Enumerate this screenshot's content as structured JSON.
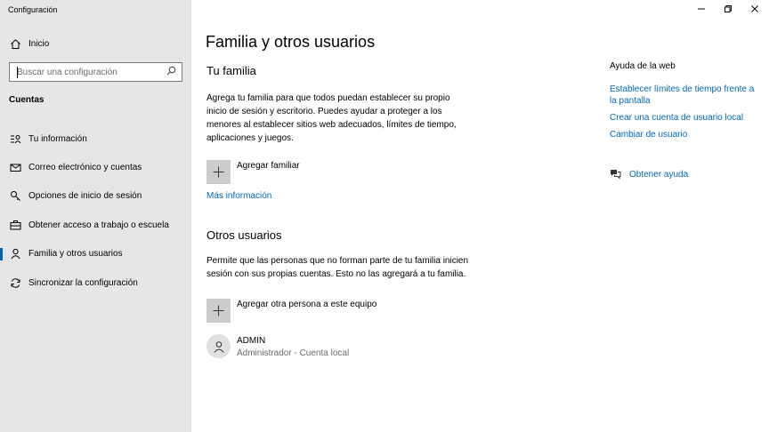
{
  "window": {
    "title": "Configuración",
    "controls": [
      "minimize-icon",
      "restore-icon",
      "close-icon"
    ]
  },
  "sidebar": {
    "home_label": "Inicio",
    "search_placeholder": "Buscar una configuración",
    "section_title": "Cuentas",
    "items": [
      {
        "label": "Tu información",
        "icon": "person-card-icon",
        "active": false
      },
      {
        "label": "Correo electrónico y cuentas",
        "icon": "mail-icon",
        "active": false
      },
      {
        "label": "Opciones de inicio de sesión",
        "icon": "key-icon",
        "active": false
      },
      {
        "label": "Obtener acceso a trabajo o escuela",
        "icon": "briefcase-icon",
        "active": false
      },
      {
        "label": "Familia y otros usuarios",
        "icon": "person-icon",
        "active": true
      },
      {
        "label": "Sincronizar la configuración",
        "icon": "sync-icon",
        "active": false
      }
    ]
  },
  "main": {
    "title": "Familia y otros usuarios",
    "family": {
      "heading": "Tu familia",
      "description": "Agrega tu familia para que todos puedan establecer su propio inicio de sesión y escritorio. Puedes ayudar a proteger a los menores al establecer sitios web adecuados, límites de tiempo, aplicaciones y juegos.",
      "add_label": "Agregar familiar",
      "more_info": "Más información"
    },
    "others": {
      "heading": "Otros usuarios",
      "description": "Permite que las personas que no forman parte de tu familia inicien sesión con sus propias cuentas. Esto no las agregará a tu familia.",
      "add_label": "Agregar otra persona a este equipo",
      "user": {
        "name": "ADMIN",
        "detail": "Administrador - Cuenta local"
      }
    }
  },
  "help": {
    "heading": "Ayuda de la web",
    "links": [
      "Establecer límites de tiempo frente a la pantalla",
      "Crear una cuenta de usuario local",
      "Cambiar de usuario"
    ],
    "get_help": "Obtener ayuda"
  },
  "colors": {
    "accent": "#0067b8",
    "sidebar_bg": "#e6e6e6",
    "active_bar": "#0063b1"
  }
}
